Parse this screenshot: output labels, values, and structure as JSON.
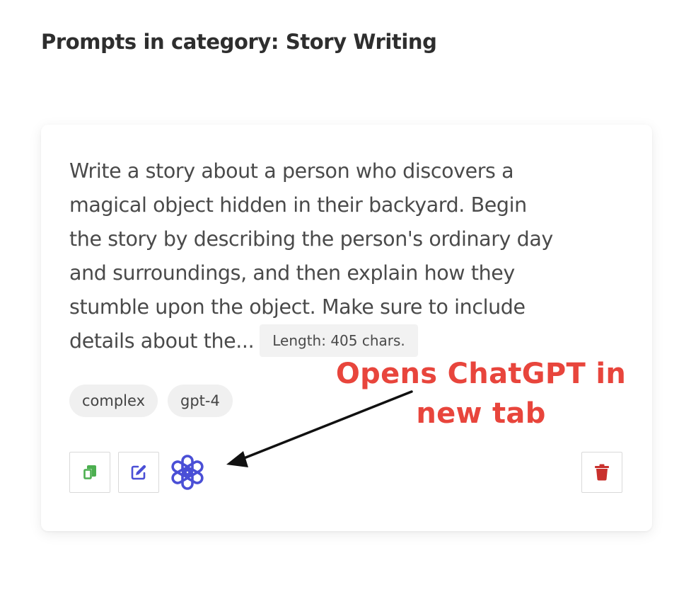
{
  "header": {
    "title": "Prompts in category: Story Writing"
  },
  "prompt_card": {
    "text_lines": [
      "Write a story about a person who discovers a",
      "magical object hidden in their backyard. Begin",
      "the story by describing the person's ordinary day",
      "and surroundings, and then explain how they",
      "stumble upon the object. Make sure to include",
      "details about the..."
    ],
    "length_label": "Length: 405 chars.",
    "tags": [
      "complex",
      "gpt-4"
    ],
    "actions": {
      "copy_icon": "copy-icon",
      "edit_icon": "edit-icon",
      "chatgpt_icon": "openai-logo-icon",
      "delete_icon": "trash-icon"
    }
  },
  "annotation": {
    "lines": [
      "Opens ChatGPT in",
      "new tab"
    ]
  },
  "colors": {
    "copy_icon": "#4caf50",
    "edit_icon": "#4a4fd6",
    "chatgpt_icon": "#4a4fd6",
    "delete_icon": "#c9302c",
    "annotation": "#e8453c"
  }
}
